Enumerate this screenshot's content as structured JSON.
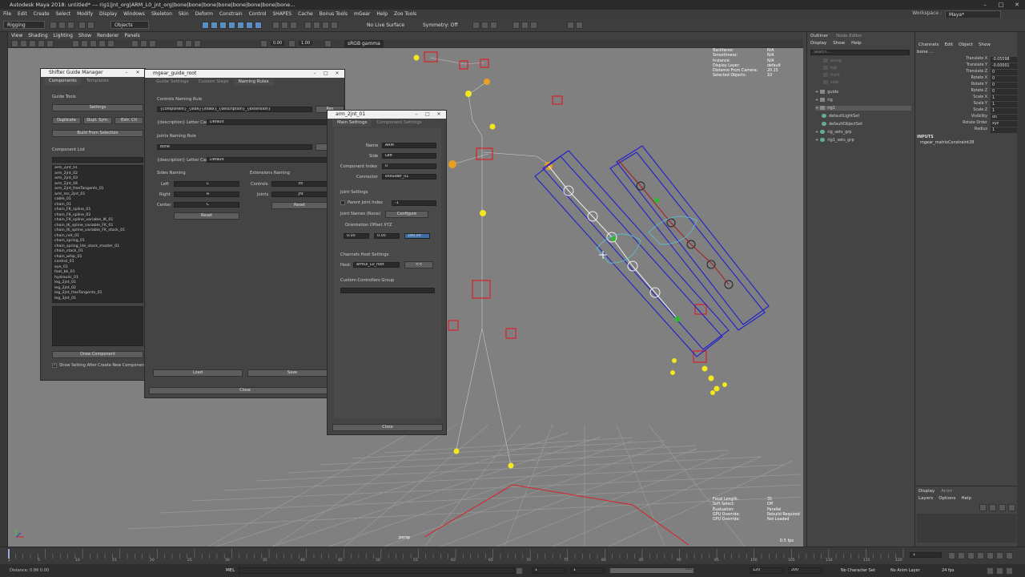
{
  "app": {
    "title": "Autodesk Maya 2018: untitled*   ---   rig1|jnt_org|ARM_L0_jnt_org|bone|bone|bone|bone|bone|bone|bone|bone...",
    "window_controls": [
      "–",
      "□",
      "✕"
    ],
    "menu": [
      "File",
      "Edit",
      "Create",
      "Select",
      "Modify",
      "Display",
      "Windows",
      "Skeleton",
      "Skin",
      "Deform",
      "Constrain",
      "Control",
      "SHAPES",
      "Cache",
      "Bonus Tools",
      "mGear",
      "Help",
      "Zoo Tools"
    ],
    "workspace_label": "Workspace :",
    "workspace_value": "Maya*"
  },
  "statusline": {
    "menuset": "Rigging",
    "objects": "Objects",
    "live_surface": "No Live Surface",
    "symmetry": "Symmetry: Off"
  },
  "viewport": {
    "menu": [
      "View",
      "Shading",
      "Lighting",
      "Show",
      "Renderer",
      "Panels"
    ],
    "gamma": "sRGB gamma",
    "field_a": "0.00",
    "field_b": "1.00",
    "hud_top": [
      {
        "k": "Backfaces:",
        "v": "N/A"
      },
      {
        "k": "Smoothness:",
        "v": "N/A"
      },
      {
        "k": "Instance:",
        "v": "N/A"
      },
      {
        "k": "Display Layer:",
        "v": "default"
      },
      {
        "k": "Distance From Camera:",
        "v": "20.15"
      },
      {
        "k": "Selected Objects:",
        "v": "10"
      }
    ],
    "hud_bottom": [
      {
        "k": "Focal Length:",
        "v": "35"
      },
      {
        "k": "Soft Select:",
        "v": "Off"
      },
      {
        "k": "Evaluation:",
        "v": "Parallel"
      },
      {
        "k": "GPU Override:",
        "v": "Rebuild Required"
      },
      {
        "k": "GPU Override:",
        "v": "Not Loaded"
      }
    ],
    "fps": "0.5 fps",
    "persp": "persp"
  },
  "guide_manager": {
    "title": "Shifter Guide Manager",
    "tabs": [
      "Components",
      "Templates"
    ],
    "guide_tools": "Guide Tools",
    "settings_btn": "Settings",
    "duplicate_btn": "Duplicate",
    "dupl_sym_btn": "Dupl. Sym.",
    "extr_ctl_btn": "Extr. Ctl",
    "build_btn": "Build From Selection",
    "component_list": "Component List",
    "components": [
      "arm_2jnt_01",
      "arm_2jnt_02",
      "arm_2jnt_03",
      "arm_2jnt_04",
      "arm_2jnt_freeTangents_01",
      "arm_ms_2jnt_01",
      "cable_01",
      "chain_01",
      "chain_FK_spline_01",
      "chain_FK_spline_02",
      "chain_FK_spline_variable_IK_01",
      "chain_IK_spline_variable_FK_01",
      "chain_IK_spline_variable_FK_stack_01",
      "chain_net_01",
      "chain_spring_01",
      "chain_spring_lite_stack_master_01",
      "chain_stack_01",
      "chain_whip_01",
      "control_01",
      "eye_01",
      "foot_bk_01",
      "hydraulic_01",
      "leg_2jnt_01",
      "leg_2jnt_02",
      "leg_2jnt_freeTangents_01",
      "leg_3jnt_01"
    ],
    "draw_btn": "Draw Component",
    "show_setting": "Show Setting After Create New Component"
  },
  "guide_root": {
    "title": "mgear_guide_root",
    "tabs": [
      "Guide Settings",
      "Custom Steps",
      "Naming Rules"
    ],
    "controls_rule": "Controls Naming Rule",
    "controls_rule_value": "{component}_{side}{index}_{description}_{extension}",
    "reset1": "Res",
    "desc_case": "{description} Letter Case",
    "desc_case_value": "Default",
    "joints_rule": "Joints Naming Rule",
    "joints_rule_value": "bone",
    "reset2": "Res",
    "desc_case2": "{description} Letter Case",
    "desc_case2_value": "Default",
    "sides_naming": "Sides Naming",
    "left_lbl": "Left",
    "left_val": "L",
    "right_lbl": "Right",
    "right_val": "R",
    "center_lbl": "Center",
    "center_val": "C",
    "reset_sides": "Reset",
    "ext_naming": "Extensions Naming",
    "controls_lbl": "Controls",
    "controls_val": "ctl",
    "joints_lbl": "Joints",
    "joints_val": "jnt",
    "reset_ext": "Reset",
    "load_btn": "Load",
    "save_btn": "Save",
    "close_btn": "Close"
  },
  "arm_settings": {
    "title": "arm_2jnt_01",
    "tabs": [
      "Main Settings",
      "Component Settings"
    ],
    "name_lbl": "Name",
    "name_val": "ARM",
    "side_lbl": "Side",
    "side_val": "Left",
    "index_lbl": "Component Index",
    "index_val": "0",
    "connector_lbl": "Connector",
    "connector_val": "shoulder_01",
    "joint_settings": "Joint Settings",
    "parent_joint_lbl": "Parent Joint Index",
    "parent_joint_val": "-1",
    "joint_names_lbl": "Joint Names (None)",
    "configure_btn": "Configure",
    "orient_lbl": "Orientation Offset XYZ",
    "orient_x": "0.00",
    "orient_y": "0.00",
    "orient_z": "180.00",
    "channels_host": "Channels Host Settings",
    "host_lbl": "Host:",
    "host_val": "armUI_L0_root",
    "host_btn": "<<",
    "custom_ctl": "Custom Controllers Group",
    "close_btn": "Close"
  },
  "outliner": {
    "tabs": [
      "Outliner",
      "Node Editor"
    ],
    "menu": [
      "Display",
      "Show",
      "Help"
    ],
    "search": "Search...",
    "items": [
      {
        "label": "persp",
        "dim": true
      },
      {
        "label": "top",
        "dim": true
      },
      {
        "label": "front",
        "dim": true
      },
      {
        "label": "side",
        "dim": true
      },
      {
        "label": "guide",
        "dim": false
      },
      {
        "label": "rig",
        "dim": false
      },
      {
        "label": "rig1",
        "dim": false
      },
      {
        "label": "defaultLightSet",
        "dim": false
      },
      {
        "label": "defaultObjectSet",
        "dim": false
      },
      {
        "label": "rig_sets_grp",
        "dim": false
      },
      {
        "label": "rig1_sets_grp",
        "dim": false
      }
    ]
  },
  "channelbox": {
    "menu": [
      "Channels",
      "Edit",
      "Object",
      "Show"
    ],
    "object": "bone ...",
    "channels": [
      {
        "k": "Translate X",
        "v": "-0.05598"
      },
      {
        "k": "Translate Y",
        "v": "-0.00001"
      },
      {
        "k": "Translate Z",
        "v": "0"
      },
      {
        "k": "Rotate X",
        "v": "0"
      },
      {
        "k": "Rotate Y",
        "v": "0"
      },
      {
        "k": "Rotate Z",
        "v": "0"
      },
      {
        "k": "Scale X",
        "v": "1"
      },
      {
        "k": "Scale Y",
        "v": "1"
      },
      {
        "k": "Scale Z",
        "v": "1"
      },
      {
        "k": "Visibility",
        "v": "on"
      },
      {
        "k": "Rotate Order",
        "v": "xyz"
      },
      {
        "k": "Radius",
        "v": "1"
      }
    ],
    "inputs": "INPUTS",
    "input_node": "mgear_matrixConstraint28",
    "layer_tabs": [
      "Display",
      "Anim"
    ],
    "layer_menu": [
      "Layers",
      "Options",
      "Help"
    ]
  },
  "timeline": {
    "ticks": [
      "1",
      "5",
      "10",
      "15",
      "20",
      "25",
      "30",
      "35",
      "40",
      "45",
      "50",
      "55",
      "60",
      "65",
      "70",
      "75",
      "80",
      "85",
      "90",
      "95",
      "100",
      "105",
      "110",
      "115",
      "120"
    ],
    "current_frame": "1",
    "range_start": "1",
    "range_start2": "1",
    "range_end": "120",
    "range_end2": "120",
    "anim_end": "200",
    "no_char": "No Character Set",
    "no_anim_layer": "No Anim Layer",
    "fps": "24 fps",
    "mel": "MEL",
    "status": "Distance:  0.86     0.00"
  },
  "colors": {
    "bg": "#444444",
    "viewport": "#808080",
    "accent": "#5a8fc4",
    "title_light": "#f0f0f0",
    "ctl_red": "#d9202a",
    "ctl_yellow": "#f2e81a",
    "ctl_blue": "#1f1fcc"
  }
}
